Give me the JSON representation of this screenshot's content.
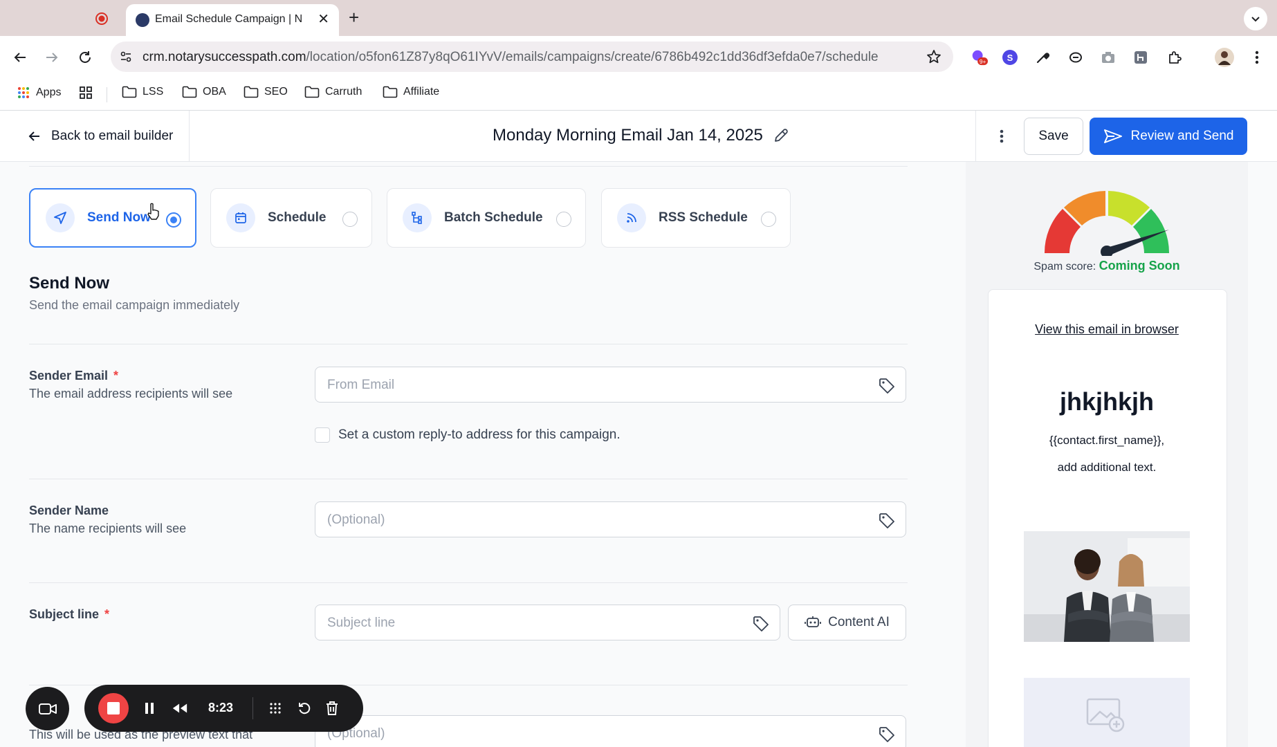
{
  "browser": {
    "tab_title": "Email Schedule Campaign | N",
    "url_host": "crm.notarysuccesspath.com",
    "url_path": "/location/o5fon61Z87y8qO61IYvV/emails/campaigns/create/6786b492c1dd36df3efda0e7/schedule",
    "extension_badge": "9+",
    "extension_letter": "S",
    "bookmarks": [
      {
        "label": "Apps",
        "icon": "apps-grid-icon"
      },
      {
        "label": "LSS",
        "icon": "folder-icon"
      },
      {
        "label": "OBA",
        "icon": "folder-icon"
      },
      {
        "label": "SEO",
        "icon": "folder-icon"
      },
      {
        "label": "Carruth",
        "icon": "folder-icon"
      },
      {
        "label": "Affiliate",
        "icon": "folder-icon"
      }
    ]
  },
  "header": {
    "back_label": "Back to email builder",
    "campaign_title": "Monday Morning Email Jan 14, 2025",
    "save_label": "Save",
    "review_label": "Review and Send",
    "accent_color": "#1d64e8"
  },
  "send_options": [
    {
      "label": "Send Now",
      "icon": "send-plane-icon",
      "selected": true
    },
    {
      "label": "Schedule",
      "icon": "calendar-icon",
      "selected": false
    },
    {
      "label": "Batch Schedule",
      "icon": "batch-tree-icon",
      "selected": false
    },
    {
      "label": "RSS Schedule",
      "icon": "rss-icon",
      "selected": false
    }
  ],
  "section": {
    "title": "Send Now",
    "description": "Send the email campaign immediately"
  },
  "fields": {
    "sender_email": {
      "label": "Sender Email",
      "required_mark": "*",
      "help": "The email address recipients will see",
      "placeholder": "From Email",
      "reply_to_label": "Set a custom reply-to address for this campaign."
    },
    "sender_name": {
      "label": "Sender Name",
      "help": "The name recipients will see",
      "placeholder": "(Optional)"
    },
    "subject": {
      "label": "Subject line",
      "required_mark": "*",
      "placeholder": "Subject line",
      "content_ai_label": "Content AI"
    },
    "preview_text": {
      "help": "This will be used as the preview text that",
      "placeholder": "(Optional)"
    }
  },
  "recorder": {
    "time": "8:23"
  },
  "preview": {
    "spam_label": "Spam score:",
    "spam_value": "Coming Soon",
    "view_in_browser": "View this email in browser",
    "heading": "jhkjhkjh",
    "line1": "{{contact.first_name}},",
    "line2": "add additional text."
  }
}
